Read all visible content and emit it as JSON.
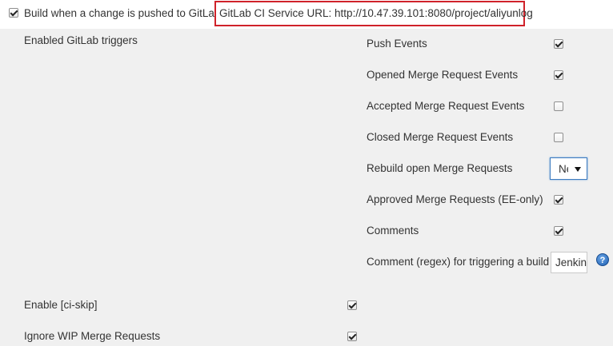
{
  "build_trigger": {
    "label": "Build when a change is pushed to GitLab.",
    "checked": true,
    "service_url_text": "GitLab CI Service URL: http://10.47.39.101:8080/project/aliyunlog"
  },
  "enabled_triggers_label": "Enabled GitLab triggers",
  "triggers": [
    {
      "label": "Push Events",
      "checked": true
    },
    {
      "label": "Opened Merge Request Events",
      "checked": true
    },
    {
      "label": "Accepted Merge Request Events",
      "checked": false
    },
    {
      "label": "Closed Merge Request Events",
      "checked": false
    },
    {
      "label": "Rebuild open Merge Requests",
      "select_value": "Ne"
    },
    {
      "label": "Approved Merge Requests (EE-only)",
      "checked": true
    },
    {
      "label": "Comments",
      "checked": true
    },
    {
      "label": "Comment (regex) for triggering a build",
      "input_value": "Jenkins"
    }
  ],
  "options": [
    {
      "label": "Enable [ci-skip]",
      "checked": true
    },
    {
      "label": "Ignore WIP Merge Requests",
      "checked": true
    }
  ],
  "help_icon_glyph": "?",
  "colors": {
    "highlight_border": "#d0222a",
    "page_background": "#f0f0f0",
    "select_focus": "#3d7bc0",
    "help_icon": "#1f5fb0"
  }
}
